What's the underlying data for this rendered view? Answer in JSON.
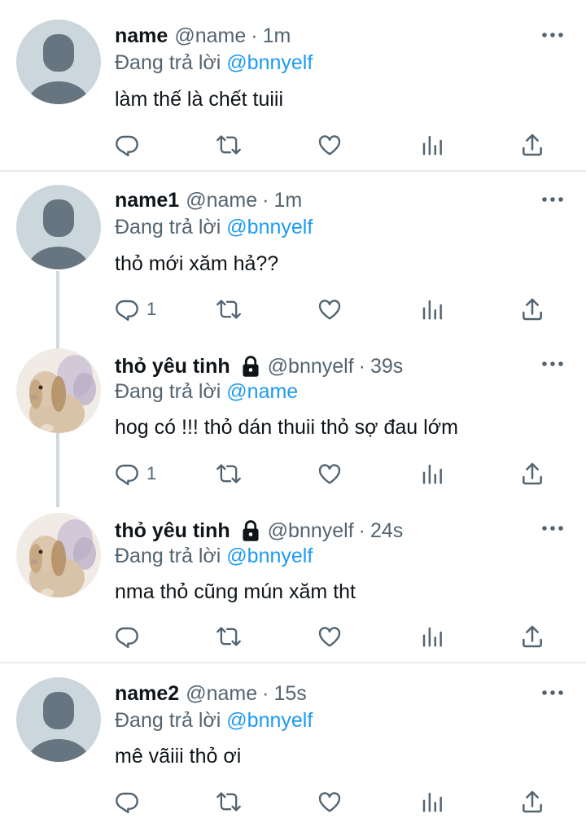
{
  "replying_prefix": "Đang trả lời",
  "colors": {
    "accent": "#1d9bf0",
    "muted": "#536471",
    "text": "#0f1419",
    "divider": "#e6ecf0"
  },
  "tweets": [
    {
      "name": "name",
      "handle": "@name",
      "time": "1m",
      "reply_to": "@bnnyelf",
      "text": "làm thế là chết tuiii",
      "reply_count": "",
      "avatar": "default-avatar",
      "locked": false
    },
    {
      "name": "name1",
      "handle": "@name",
      "time": "1m",
      "reply_to": "@bnnyelf",
      "text": "thỏ mới xăm hả??",
      "reply_count": "1",
      "avatar": "default-avatar",
      "locked": false
    },
    {
      "name": "thỏ yêu tinh",
      "handle": "@bnnyelf",
      "time": "39s",
      "reply_to": "@name",
      "text": "hog có !!! thỏ dán thuii thỏ sợ đau lớm",
      "reply_count": "1",
      "avatar": "bunny-avatar",
      "locked": true
    },
    {
      "name": "thỏ yêu tinh",
      "handle": "@bnnyelf",
      "time": "24s",
      "reply_to": "@bnnyelf",
      "text": "nma thỏ cũng mún xăm tht",
      "reply_count": "",
      "avatar": "bunny-avatar",
      "locked": true
    },
    {
      "name": "name2",
      "handle": "@name",
      "time": "15s",
      "reply_to": "@bnnyelf",
      "text": "mê vãiii thỏ ơi",
      "reply_count": "",
      "avatar": "default-avatar",
      "locked": false
    }
  ]
}
